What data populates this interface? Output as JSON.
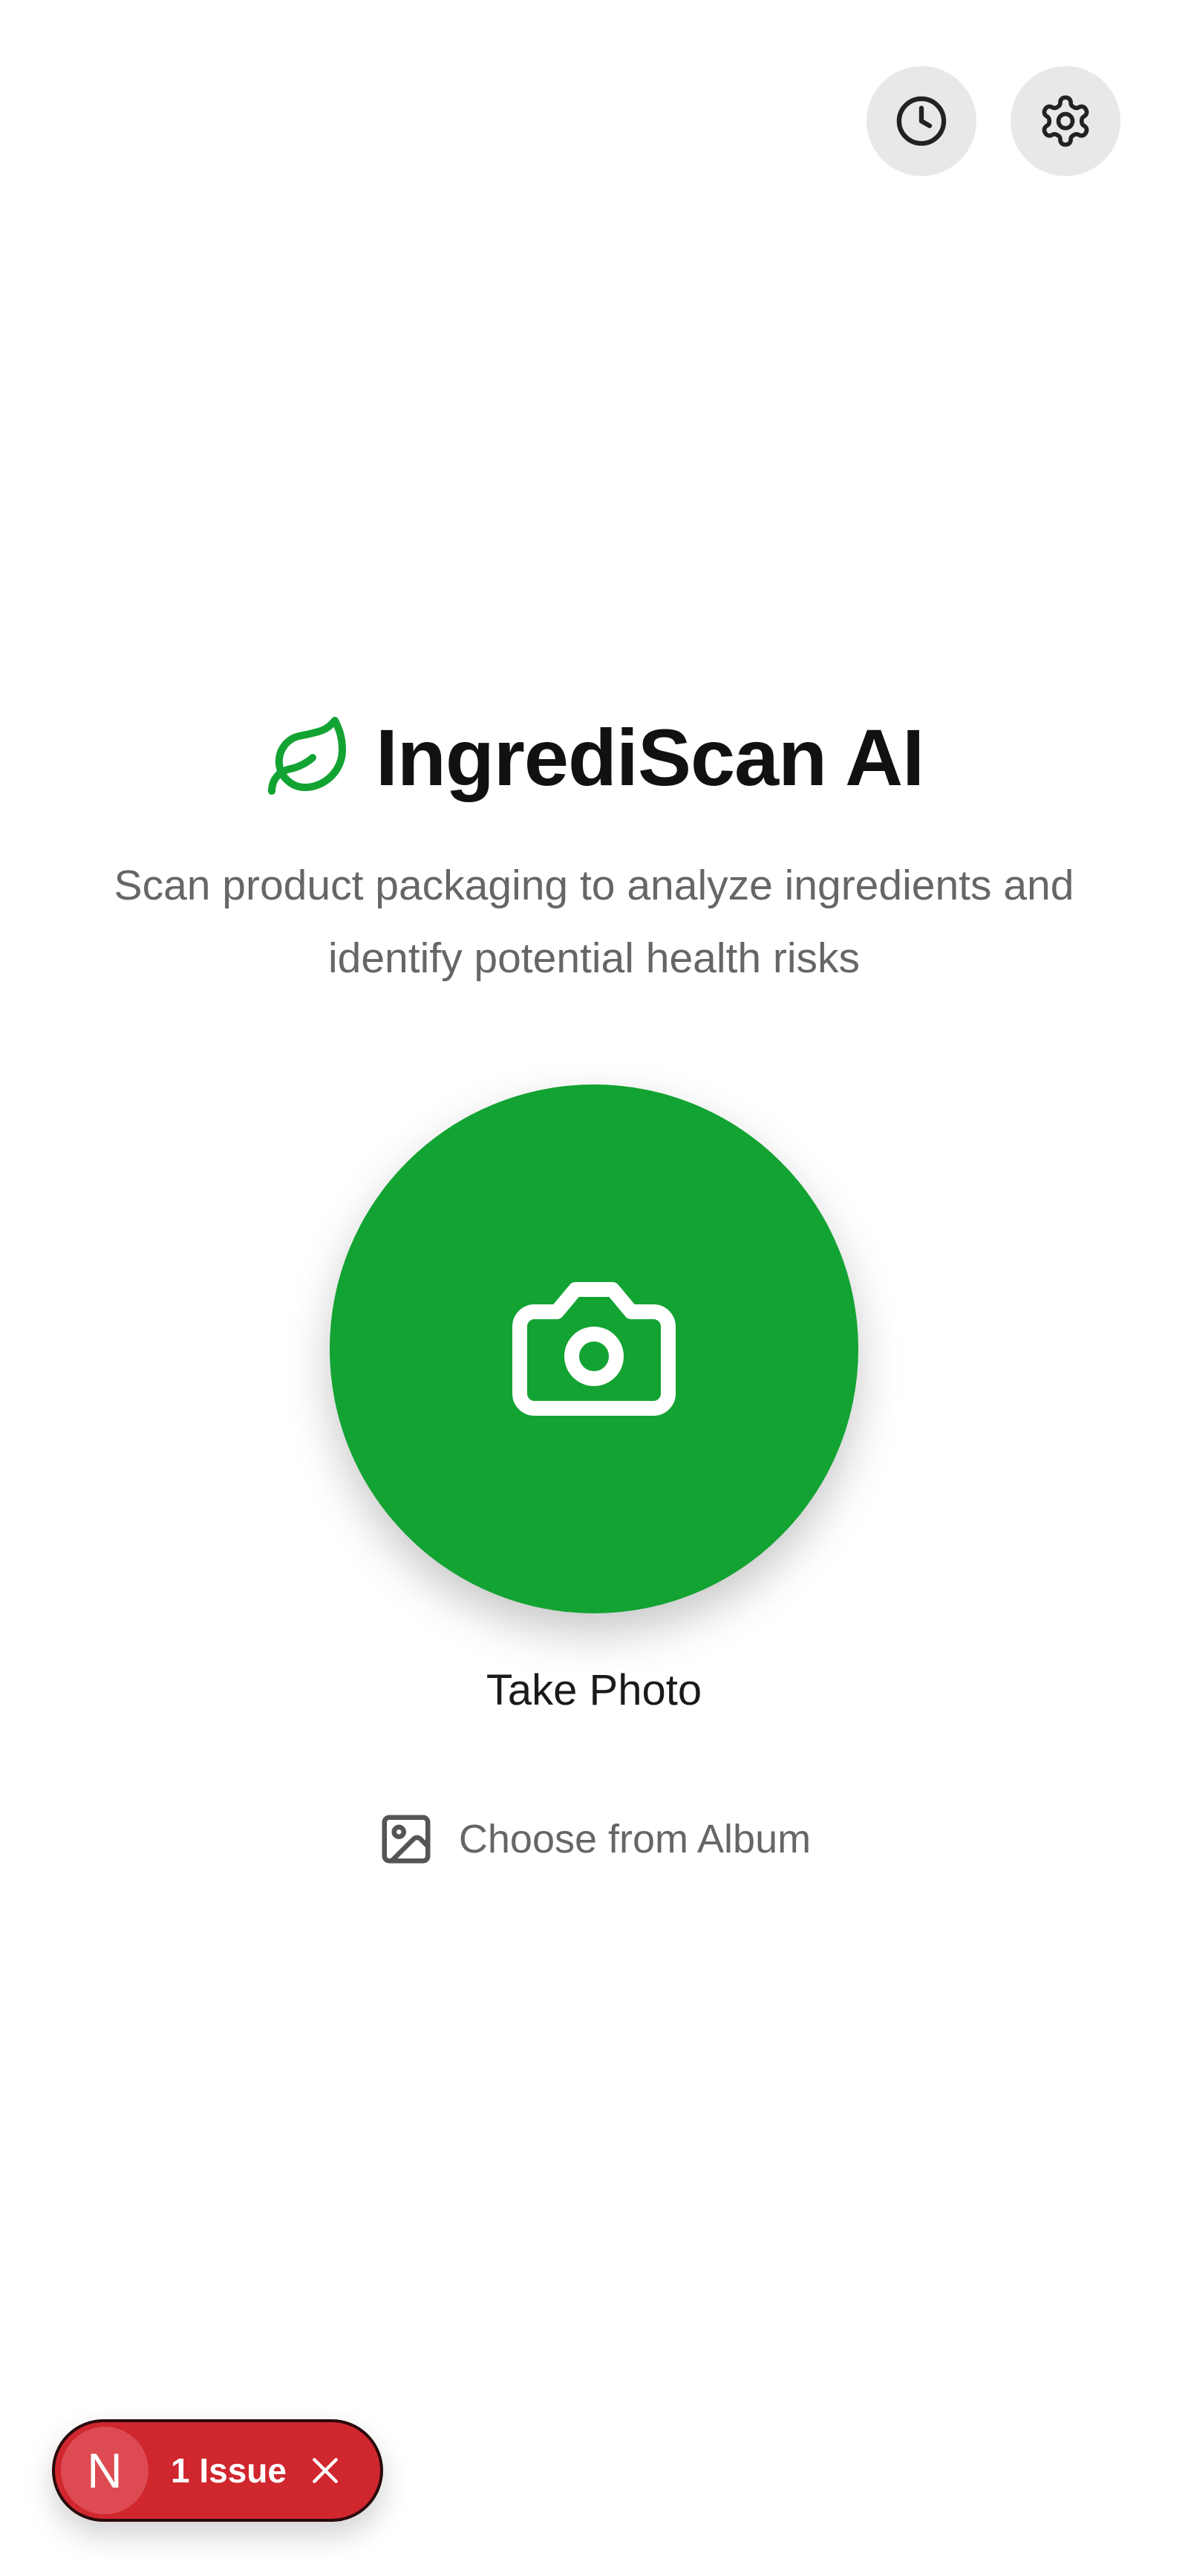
{
  "header": {
    "history_icon": "clock-icon",
    "settings_icon": "gear-icon"
  },
  "hero": {
    "icon": "leaf-icon",
    "title": "IngrediScan AI",
    "subtitle": "Scan product packaging to analyze ingredients and identify potential health risks"
  },
  "actions": {
    "camera_icon": "camera-icon",
    "take_photo_label": "Take Photo",
    "album_icon": "image-icon",
    "album_label": "Choose from Album"
  },
  "issue_badge": {
    "logo_letter": "N",
    "label": "1 Issue",
    "close_icon": "close-icon"
  },
  "colors": {
    "accent": "#12a332",
    "badge": "#d0262e",
    "button_bg": "#e8e8e8",
    "text_muted": "#666666"
  }
}
